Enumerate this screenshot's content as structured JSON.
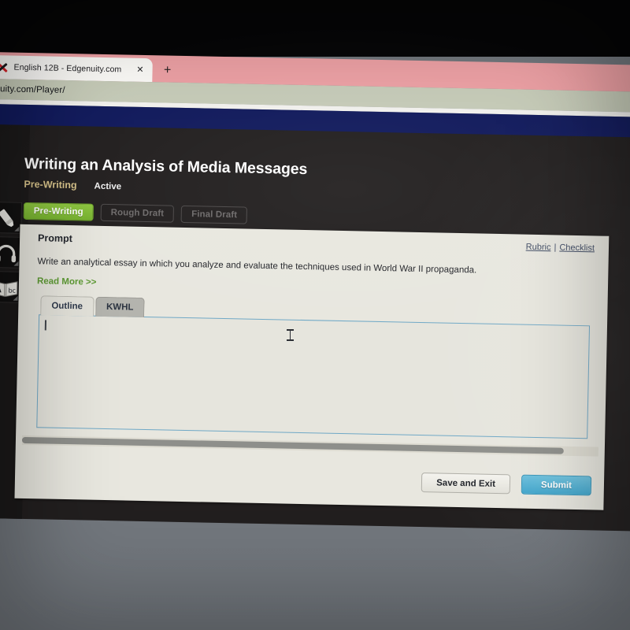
{
  "browser": {
    "tab": {
      "title": "English 12B - Edgenuity.com",
      "favicon_name": "edgenuity-x-favicon",
      "close_label": "✕"
    },
    "new_tab_label": "+",
    "url": "enuity.com/Player/"
  },
  "app": {
    "page_title": "Writing an Analysis of Media Messages",
    "stage_name": "Pre-Writing",
    "stage_state": "Active",
    "stage_buttons": [
      {
        "label": "Pre-Writing",
        "state": "current"
      },
      {
        "label": "Rough Draft",
        "state": "locked"
      },
      {
        "label": "Final Draft",
        "state": "locked"
      }
    ],
    "tools": [
      {
        "name": "highlighter-icon",
        "title": "Highlighter"
      },
      {
        "name": "audio-headphones-icon",
        "title": "Text to Speech"
      },
      {
        "name": "glossary-book-icon",
        "title": "Glossary"
      }
    ]
  },
  "card": {
    "prompt_label": "Prompt",
    "links": {
      "rubric": "Rubric",
      "separator": "|",
      "checklist": "Checklist"
    },
    "prompt_text": "Write an analytical essay in which you analyze and evaluate the techniques used in World War II propaganda.",
    "read_more": "Read More >>",
    "tabs": [
      {
        "label": "Outline",
        "active": true
      },
      {
        "label": "KWHL",
        "active": false
      }
    ],
    "essay": {
      "value": "",
      "placeholder": ""
    },
    "footer": {
      "save_label": "Save and Exit",
      "submit_label": "Submit"
    }
  },
  "colors": {
    "stage_current_green": "#8dc63f",
    "submit_blue": "#42a6cc",
    "link_blue": "#3e4a63",
    "read_more_green": "#5d9a33",
    "stage_gold": "#d8c38a",
    "navy_band": "#111a5c",
    "tabstrip_pink": "#eda0a4",
    "urlbar_green": "#c6cbb8"
  }
}
